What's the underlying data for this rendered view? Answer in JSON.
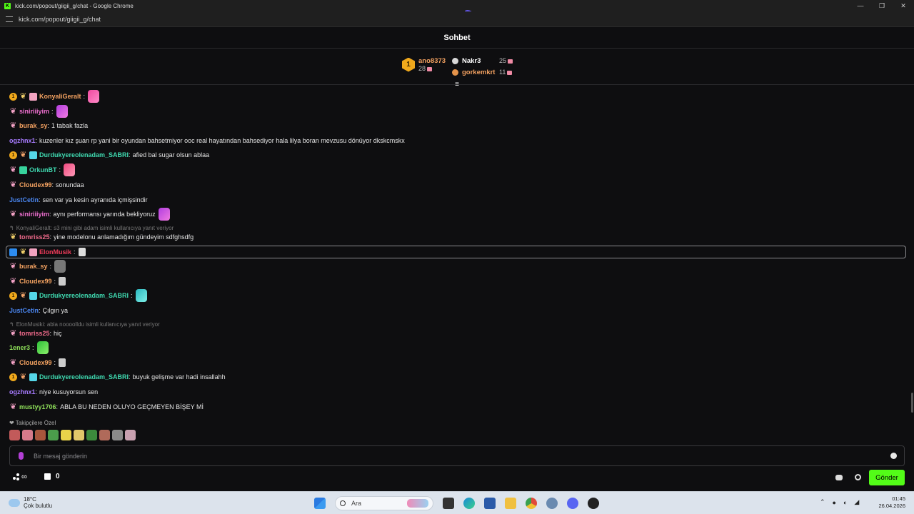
{
  "browser": {
    "window_title": "kick.com/popout/giigii_g/chat - Google Chrome",
    "url": "kick.com/popout/giigii_g/chat"
  },
  "chat": {
    "header_title": "Sohbet",
    "leaderboard": {
      "first": {
        "rank": "1",
        "name": "ano8373",
        "count": "28"
      },
      "others": [
        {
          "name": "Nakr3",
          "count": "25"
        },
        {
          "name": "gorkemkrt",
          "count": "11"
        }
      ]
    },
    "messages": [
      {
        "user": "KonyaliGeralt",
        "text": ""
      },
      {
        "user": "siniriiiyim",
        "text": ""
      },
      {
        "user": "burak_sy",
        "text": "1 tabak fazla"
      },
      {
        "user": "ogzhnx1",
        "text": "kuzenler kız şuan rp yani bir oyundan bahsetmiyor ooc real hayatından bahsediyor hala lilya boran mevzusu dönüyor dkskcmskx"
      },
      {
        "user": "Durdukyereolenadam_SABRI",
        "text": "afied bal sugar olsun ablaa"
      },
      {
        "user": "OrkunBT",
        "text": ""
      },
      {
        "user": "Cloudex99",
        "text": "sonundaa"
      },
      {
        "user": "JustCetin",
        "text": "sen var ya kesin ayranıda içmişsindir"
      },
      {
        "user": "siniriiiyim",
        "text": "aynı performansı yarında bekliyoruz"
      },
      {
        "user": "tomriss25",
        "text": "yine modelonu anlamadığım gündeyim sdfghsdfg"
      },
      {
        "user": "ElonMusik",
        "text": ""
      },
      {
        "user": "burak_sy",
        "text": ""
      },
      {
        "user": "Cloudex99",
        "text": ""
      },
      {
        "user": "Durdukyereolenadam_SABRI",
        "text": ""
      },
      {
        "user": "JustCetin",
        "text": "Çılgın ya"
      },
      {
        "user": "tomriss25",
        "text": "hiç"
      },
      {
        "user": "1ener3",
        "text": ""
      },
      {
        "user": "Cloudex99",
        "text": ""
      },
      {
        "user": "Durdukyereolenadam_SABRI",
        "text": "buyuk gelişme var hadi insallahh"
      },
      {
        "user": "ogzhnx1",
        "text": "niye kusuyorsun sen"
      },
      {
        "user": "mustyy1706",
        "text": "ABLA BU NEDEN OLUYO GEÇMEYEN BİŞEY Mİ"
      }
    ],
    "replies": [
      "KonyaliGeralt: s3 mini gibi adam isimli kullanıcıya yanıt veriyor",
      "ElonMusiki: abla noooolldu isimli kullanıcıya yanıt veriyor"
    ],
    "followers_only_label": "Takipçilere Özel",
    "input_placeholder": "Bir mesaj gönderin",
    "points_value": "∞",
    "gift_count": "0",
    "send_label": "Gönder"
  },
  "colors": {
    "accent": "#53fc18",
    "user_orange": "#f4a261",
    "user_pink": "#ef6fd0",
    "user_purple": "#a77bff",
    "user_teal": "#3fd9b0",
    "user_blue": "#4a86f0",
    "user_red": "#f03c5a",
    "user_coral": "#f06a8b",
    "user_green": "#8fe05a"
  },
  "taskbar": {
    "weather_temp": "18°C",
    "weather_desc": "Çok bulutlu",
    "search_label": "Ara",
    "time": "01:45",
    "date": "26.04.2026"
  }
}
